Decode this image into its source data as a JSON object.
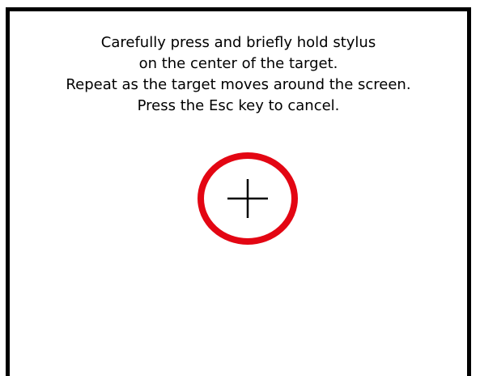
{
  "instructions": {
    "line1": "Carefully press and briefly hold stylus",
    "line2": "on the center of the target.",
    "line3": "Repeat as the target moves around the screen.",
    "line4": "Press the Esc key to cancel."
  },
  "target": {
    "icon": "calibration-target-icon",
    "ring_color": "#e30613",
    "crosshair_color": "#000000"
  },
  "colors": {
    "background": "#ffffff",
    "border": "#000000",
    "text": "#000000"
  }
}
